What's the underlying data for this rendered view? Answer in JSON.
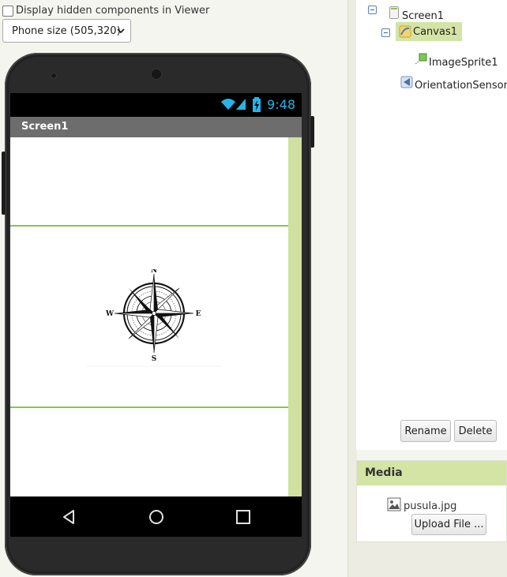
{
  "viewer": {
    "hidden_components_label": "Display hidden components in Viewer",
    "phone_size_value": "Phone size (505,320)",
    "status_time": "9:48",
    "screen_title": "Screen1"
  },
  "tree": {
    "screen": "Screen1",
    "canvas": "Canvas1",
    "sprite": "ImageSprite1",
    "sensor": "OrientationSensor1",
    "rename_label": "Rename",
    "delete_label": "Delete"
  },
  "media": {
    "header": "Media",
    "file_name": "pusula.jpg",
    "upload_label": "Upload File ..."
  },
  "compass": {
    "n": "N",
    "s": "S",
    "e": "E",
    "w": "W"
  },
  "colors": {
    "accent": "#8bc34a",
    "selection": "#d4e4a6",
    "status_blue": "#25b5e8"
  }
}
